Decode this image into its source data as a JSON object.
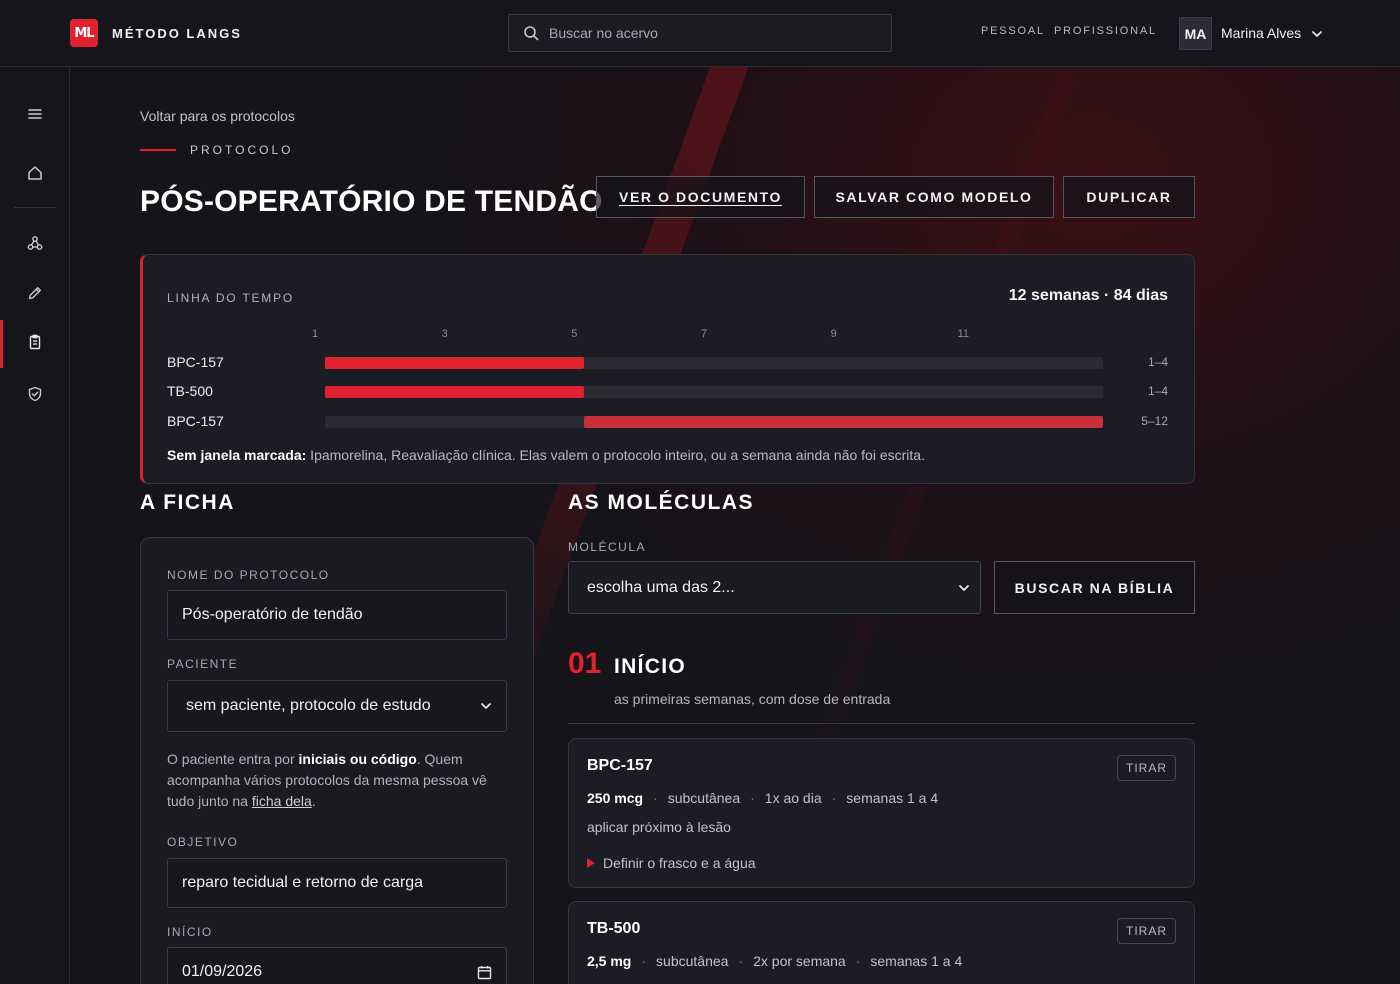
{
  "brand": {
    "mark": "ML",
    "name": "MÉTODO LANGS",
    "accent": "#e0212f"
  },
  "search": {
    "placeholder": "Buscar no acervo"
  },
  "topnav": {
    "personal": "PESSOAL",
    "professional": "PROFISSIONAL"
  },
  "user": {
    "initials": "MA",
    "name": "Marina Alves"
  },
  "sidebar": {
    "icons": [
      "menu-icon",
      "home-icon",
      "molecule-icon",
      "pen-icon",
      "clipboard-icon",
      "shield-check-icon"
    ],
    "active": "clipboard-icon"
  },
  "page": {
    "back": "Voltar para os protocolos",
    "eyebrow": "PROTOCOLO",
    "title": "PÓS-OPERATÓRIO DE TENDÃO",
    "actions": {
      "view": "VER O DOCUMENTO",
      "save_template": "SALVAR COMO MODELO",
      "duplicate": "DUPLICAR"
    }
  },
  "timeline": {
    "label": "LINHA DO TEMPO",
    "summary": "12 semanas · 84 dias",
    "total_weeks": 12,
    "week_ticks": [
      "1",
      "3",
      "5",
      "7",
      "9",
      "11"
    ],
    "rows": [
      {
        "name": "BPC-157",
        "start": 1,
        "end": 4,
        "range": "1–4",
        "color": "#e0212f"
      },
      {
        "name": "TB-500",
        "start": 1,
        "end": 4,
        "range": "1–4",
        "color": "#e0212f"
      },
      {
        "name": "BPC-157",
        "start": 5,
        "end": 12,
        "range": "5–12",
        "color": "#c92f3b"
      }
    ],
    "note_bold": "Sem janela marcada:",
    "note_text": " Ipamorelina, Reavaliação clínica. Elas valem o protocolo inteiro, ou a semana ainda não foi escrita."
  },
  "ficha": {
    "title": "A FICHA",
    "name_label": "NOME DO PROTOCOLO",
    "name_value": "Pós-operatório de tendão",
    "patient_label": "PACIENTE",
    "patient_value": "sem paciente, protocolo de estudo",
    "help_1": "O paciente entra por ",
    "help_bold": "iniciais ou código",
    "help_2": ". Quem acompanha vários protocolos da mesma pessoa vê tudo junto na ",
    "help_link": "ficha dela",
    "help_3": ".",
    "goal_label": "OBJETIVO",
    "goal_value": "reparo tecidual e retorno de carga",
    "start_label": "INÍCIO",
    "start_value": "01/09/2026"
  },
  "molecules": {
    "title": "AS MOLÉCULAS",
    "select_label": "MOLÉCULA",
    "select_value": "escolha uma das 2...",
    "search_button": "BUSCAR NA BÍBLIA",
    "phase": {
      "number": "01",
      "title": "INÍCIO",
      "subtitle": "as primeiras semanas, com dose de entrada"
    },
    "cards": [
      {
        "name": "BPC-157",
        "remove": "TIRAR",
        "dose": "250 mcg",
        "route": "subcutânea",
        "frequency": "1x ao dia",
        "weeks": "semanas 1 a 4",
        "note": "aplicar próximo à lesão",
        "expander": "Definir o frasco e a água"
      },
      {
        "name": "TB-500",
        "remove": "TIRAR",
        "dose": "2,5 mg",
        "route": "subcutânea",
        "frequency": "2x por semana",
        "weeks": "semanas 1 a 4"
      }
    ]
  }
}
